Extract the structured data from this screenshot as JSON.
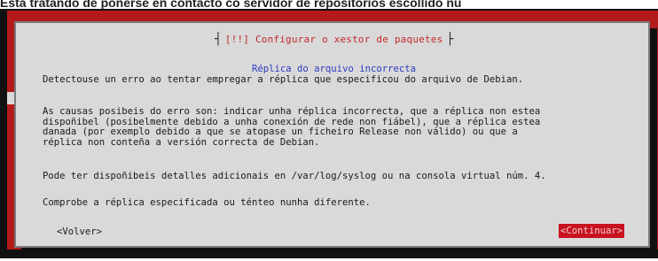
{
  "caption": "Esta tratando de ponerse en contacto co servidor de repositorios escollido nu",
  "dialog": {
    "title": "[!!] Configurar o xestor de paquetes",
    "subtitle": "Réplica do arquivo incorrecta",
    "paragraphs": [
      "Detectouse un erro ao tentar empregar a réplica que especificou do arquivo de Debian.",
      "As causas posibeis do erro son: indicar unha réplica incorrecta, que a réplica non estea\ndispoñibel (posibelmente debido a unha conexión de rede non fiábel), que a réplica estea\ndanada (por exemplo debido a que se atopase un ficheiro Release non válido) ou que a\nréplica non conteña a versión correcta de Debian.",
      "Pode ter dispoñibeis detalles adicionais en /var/log/syslog ou na consola virtual núm. 4.",
      "Comprobe a réplica especificada ou ténteo nunha diferente."
    ],
    "buttons": {
      "back": "<Volver>",
      "continue": "<Continuar>"
    }
  },
  "colors": {
    "background": "#b31b1b",
    "dialog": "#d9d9d9",
    "subtitle": "#2d3bbf",
    "selected_button": "#c8121f",
    "title": "#c22a2a"
  }
}
